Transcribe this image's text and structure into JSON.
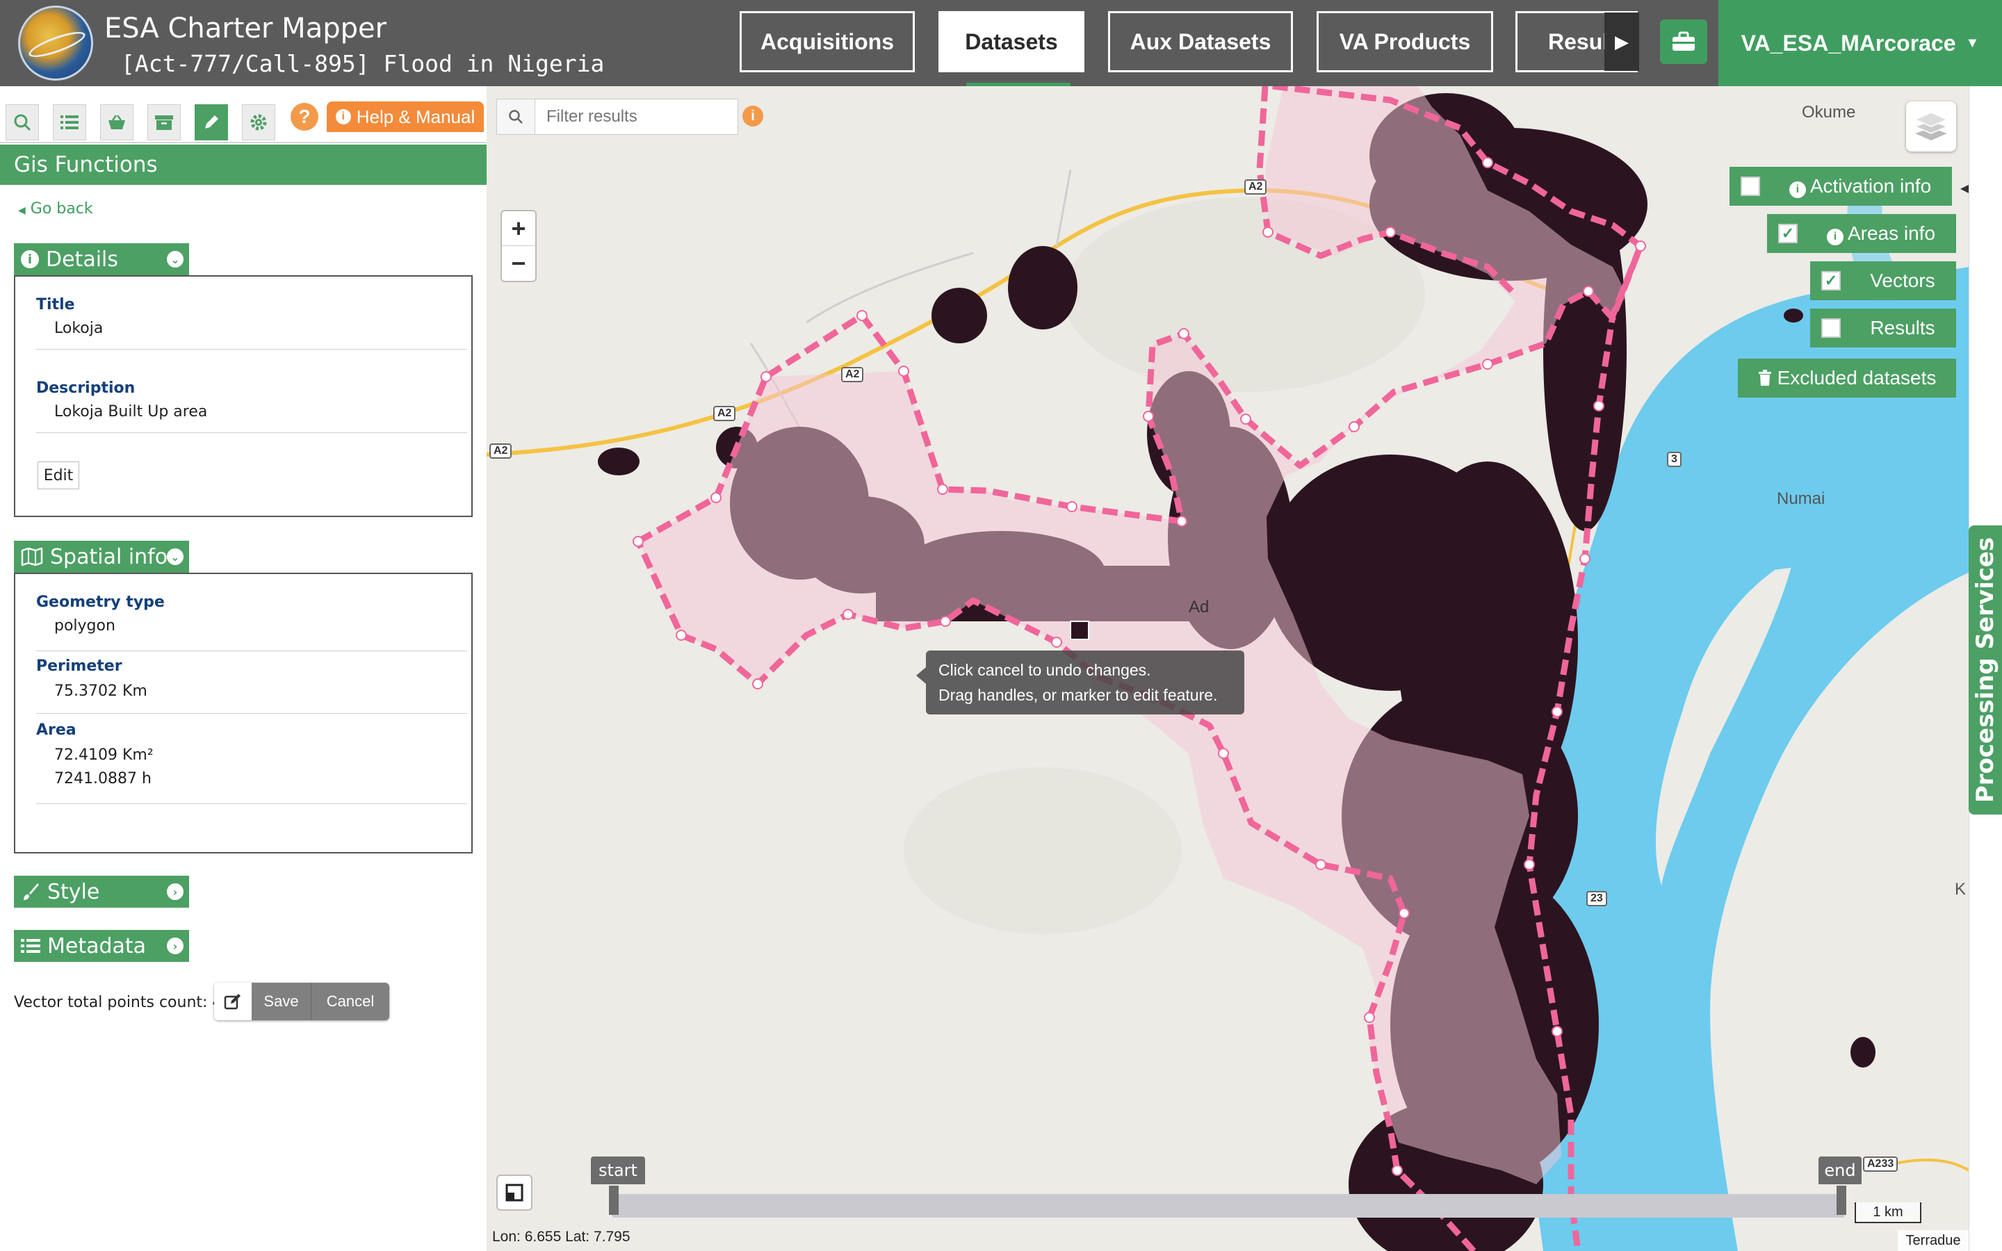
{
  "header": {
    "app_title": "ESA Charter Mapper",
    "subtitle": "[Act-777/Call-895] Flood in Nigeria",
    "nav": [
      "Acquisitions",
      "Datasets",
      "Aux Datasets",
      "VA Products",
      "Results"
    ],
    "active_nav": "Datasets",
    "user": "VA_ESA_MArcorace",
    "icons": {
      "logo": "esa-charter-logo",
      "briefcase": "briefcase-icon",
      "caret": "caret-down-icon",
      "results_scroll": "caret-right-icon"
    }
  },
  "left_panel": {
    "toolbar_icons": [
      "search-icon",
      "list-icon",
      "basket-icon",
      "archive-icon",
      "pencil-icon",
      "gear-icon"
    ],
    "help_icon": "?",
    "help_manual": "Help & Manual",
    "header": "Gis Functions",
    "go_back": "Go back",
    "details": {
      "title": "Details",
      "title_label": "Title",
      "title_value": "Lokoja",
      "description_label": "Description",
      "description_value": "Lokoja Built Up area",
      "edit_label": "Edit"
    },
    "spatial": {
      "title": "Spatial info",
      "geometry_label": "Geometry type",
      "geometry_value": "polygon",
      "perimeter_label": "Perimeter",
      "perimeter_value": "75.3702 Km",
      "area_label": "Area",
      "area_value_km2": "72.4109 Km²",
      "area_value_h": "7241.0887 h"
    },
    "style_title": "Style",
    "metadata_title": "Metadata",
    "points_count": "Vector total points count: 49",
    "save_label": "Save",
    "cancel_label": "Cancel"
  },
  "map": {
    "filter_placeholder": "Filter results",
    "zoom_in": "+",
    "zoom_out": "−",
    "tooltip_line1": "Click cancel to undo changes.",
    "tooltip_line2": "Drag handles, or marker to edit feature.",
    "layers": [
      {
        "label": "Activation info",
        "checked": false
      },
      {
        "label": "Areas info",
        "checked": true
      },
      {
        "label": "Vectors",
        "checked": true
      },
      {
        "label": "Results",
        "checked": false
      }
    ],
    "excluded_datasets": "Excluded datasets",
    "timeline_start": "start",
    "timeline_end": "end",
    "coords": "Lon: 6.655 Lat: 7.795",
    "scale": "1 km",
    "attribution": "Terradue",
    "place_labels": [
      "Okume",
      "Numai",
      "K",
      "Ad"
    ],
    "road_shields": [
      "A2",
      "A2",
      "A2",
      "A2",
      "3",
      "A233",
      "23"
    ],
    "colors": {
      "polygon_stroke": "#f0669a",
      "polygon_fill": "#f6c6d6",
      "river": "#6dcbee",
      "road": "#f5c242",
      "builtup": "#2b1420",
      "accent_green": "#4ca064"
    }
  },
  "processing_services": "Processing Services"
}
